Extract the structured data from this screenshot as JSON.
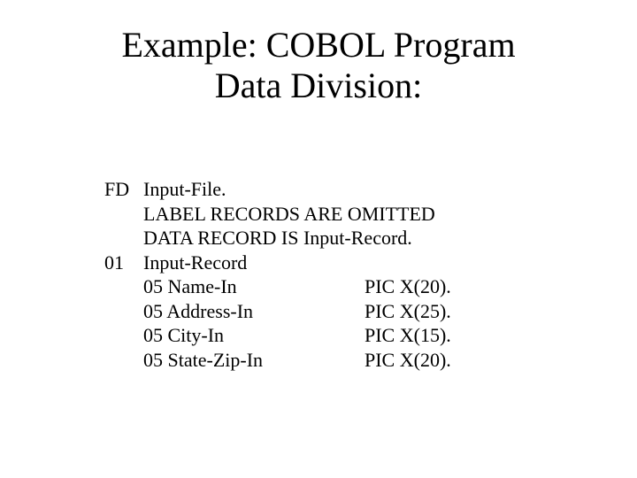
{
  "title_line1": "Example: COBOL Program",
  "title_line2": "Data Division:",
  "code": {
    "fd": "FD",
    "input_file": "Input-File.",
    "label_records": "LABEL RECORDS ARE OMITTED",
    "data_record": "DATA RECORD IS Input-Record.",
    "lvl01": "01",
    "input_record": "Input-Record",
    "f1_name": "05 Name-In",
    "f1_pic": " PIC X(20).",
    "f2_name": "05 Address-In",
    "f2_pic": " PIC X(25).",
    "f3_name": "05 City-In",
    "f3_pic": " PIC X(15).",
    "f4_name": "05 State-Zip-In",
    "f4_pic": "PIC X(20)."
  }
}
